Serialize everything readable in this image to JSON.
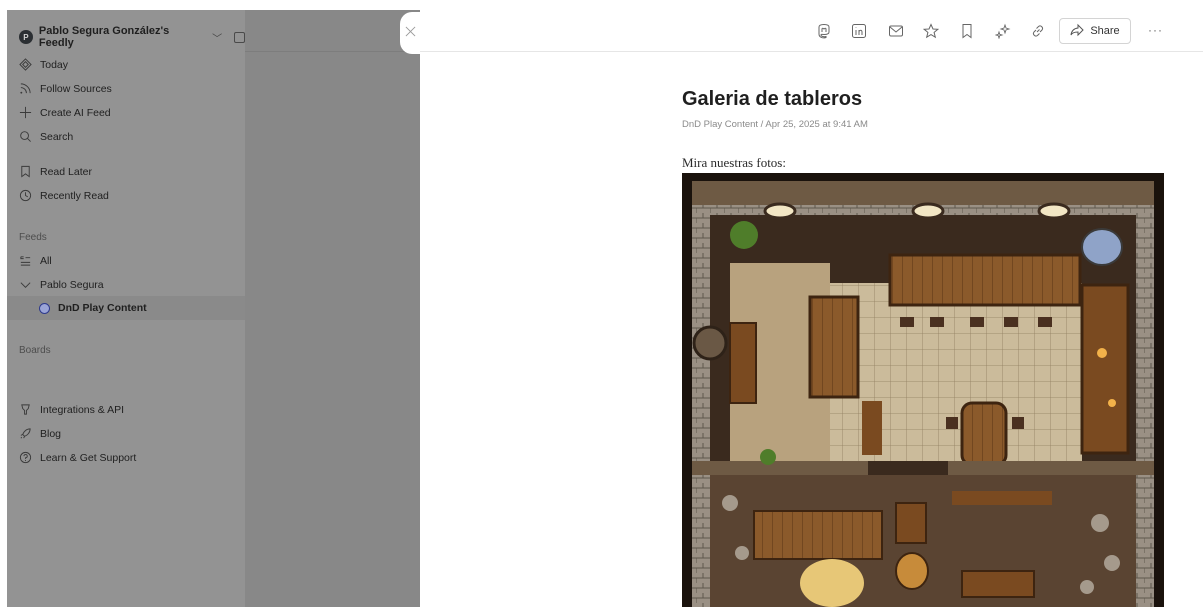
{
  "workspace": {
    "avatar_letter": "P",
    "title": "Pablo Segura González's Feedly"
  },
  "nav": [
    {
      "label": "Today",
      "icon": "today-icon"
    },
    {
      "label": "Follow Sources",
      "icon": "rss-icon"
    },
    {
      "label": "Create AI Feed",
      "icon": "plus-icon"
    },
    {
      "label": "Search",
      "icon": "search-icon"
    }
  ],
  "saved": [
    {
      "label": "Read Later",
      "icon": "bookmark-icon"
    },
    {
      "label": "Recently Read",
      "icon": "clock-icon"
    }
  ],
  "feeds": {
    "section_label": "Feeds",
    "all_label": "All",
    "folder_label": "Pablo Segura",
    "source_label": "DnD Play Content"
  },
  "boards": {
    "section_label": "Boards"
  },
  "footer_links": [
    {
      "label": "Integrations & API",
      "icon": "plug-icon"
    },
    {
      "label": "Blog",
      "icon": "rocket-icon"
    },
    {
      "label": "Learn & Get Support",
      "icon": "help-icon"
    }
  ],
  "toolbar": {
    "share_label": "Share",
    "more_label": "···",
    "icons": [
      "mastodon-icon",
      "linkedin-icon",
      "email-icon",
      "star-icon",
      "bookmark-icon",
      "ai-sparkle-icon",
      "link-icon"
    ]
  },
  "article": {
    "title": "Galeria de tableros",
    "meta": "DnD Play Content / Apr 25, 2025 at 9:41 AM",
    "body": "Mira nuestras fotos:"
  }
}
